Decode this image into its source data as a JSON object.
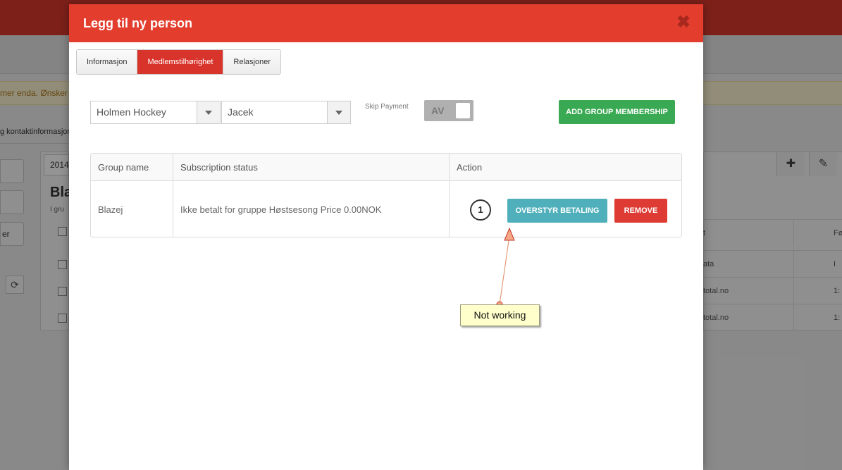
{
  "background": {
    "warning_text": "mer enda. Ønsker du",
    "contact_label": "g kontaktinformasjon",
    "year_value": "2014",
    "name_fragment": "Bla",
    "group_fragment": "I gru",
    "side_button_label": "er",
    "right_rows": [
      "ata",
      "total.no",
      "total.no"
    ],
    "right_cols": [
      "t",
      "Fø"
    ],
    "right_vals": [
      "I",
      "1:",
      "1:"
    ]
  },
  "modal": {
    "title": "Legg til ny person",
    "close_glyph": "✖",
    "tabs": [
      {
        "label": "Informasjon",
        "active": false
      },
      {
        "label": "Medlemstilhørighet",
        "active": true
      },
      {
        "label": "Relasjoner",
        "active": false
      }
    ],
    "club_select": {
      "value": "Holmen Hockey"
    },
    "person_select": {
      "value": "Jacek"
    },
    "skip_payment": {
      "label": "Skip Payment",
      "state": "AV"
    },
    "add_button": "ADD GROUP MEMBERSHIP",
    "table": {
      "headers": [
        "Group name",
        "Subscription status",
        "Action"
      ],
      "rows": [
        {
          "group": "Blazej",
          "status": "Ikke betalt for gruppe Høstsesong Price 0.00NOK"
        }
      ]
    },
    "step_number": "1",
    "override_button": "OVERSTYR BETALING",
    "remove_button": "REMOVE",
    "note_text": "Not working"
  },
  "colors": {
    "header": "#e33d2e",
    "active_tab": "#d9342b",
    "add_button": "#3aa953",
    "override_button": "#4fb0bb",
    "remove_button": "#dd3b33",
    "note_bg": "#ffffcc"
  }
}
